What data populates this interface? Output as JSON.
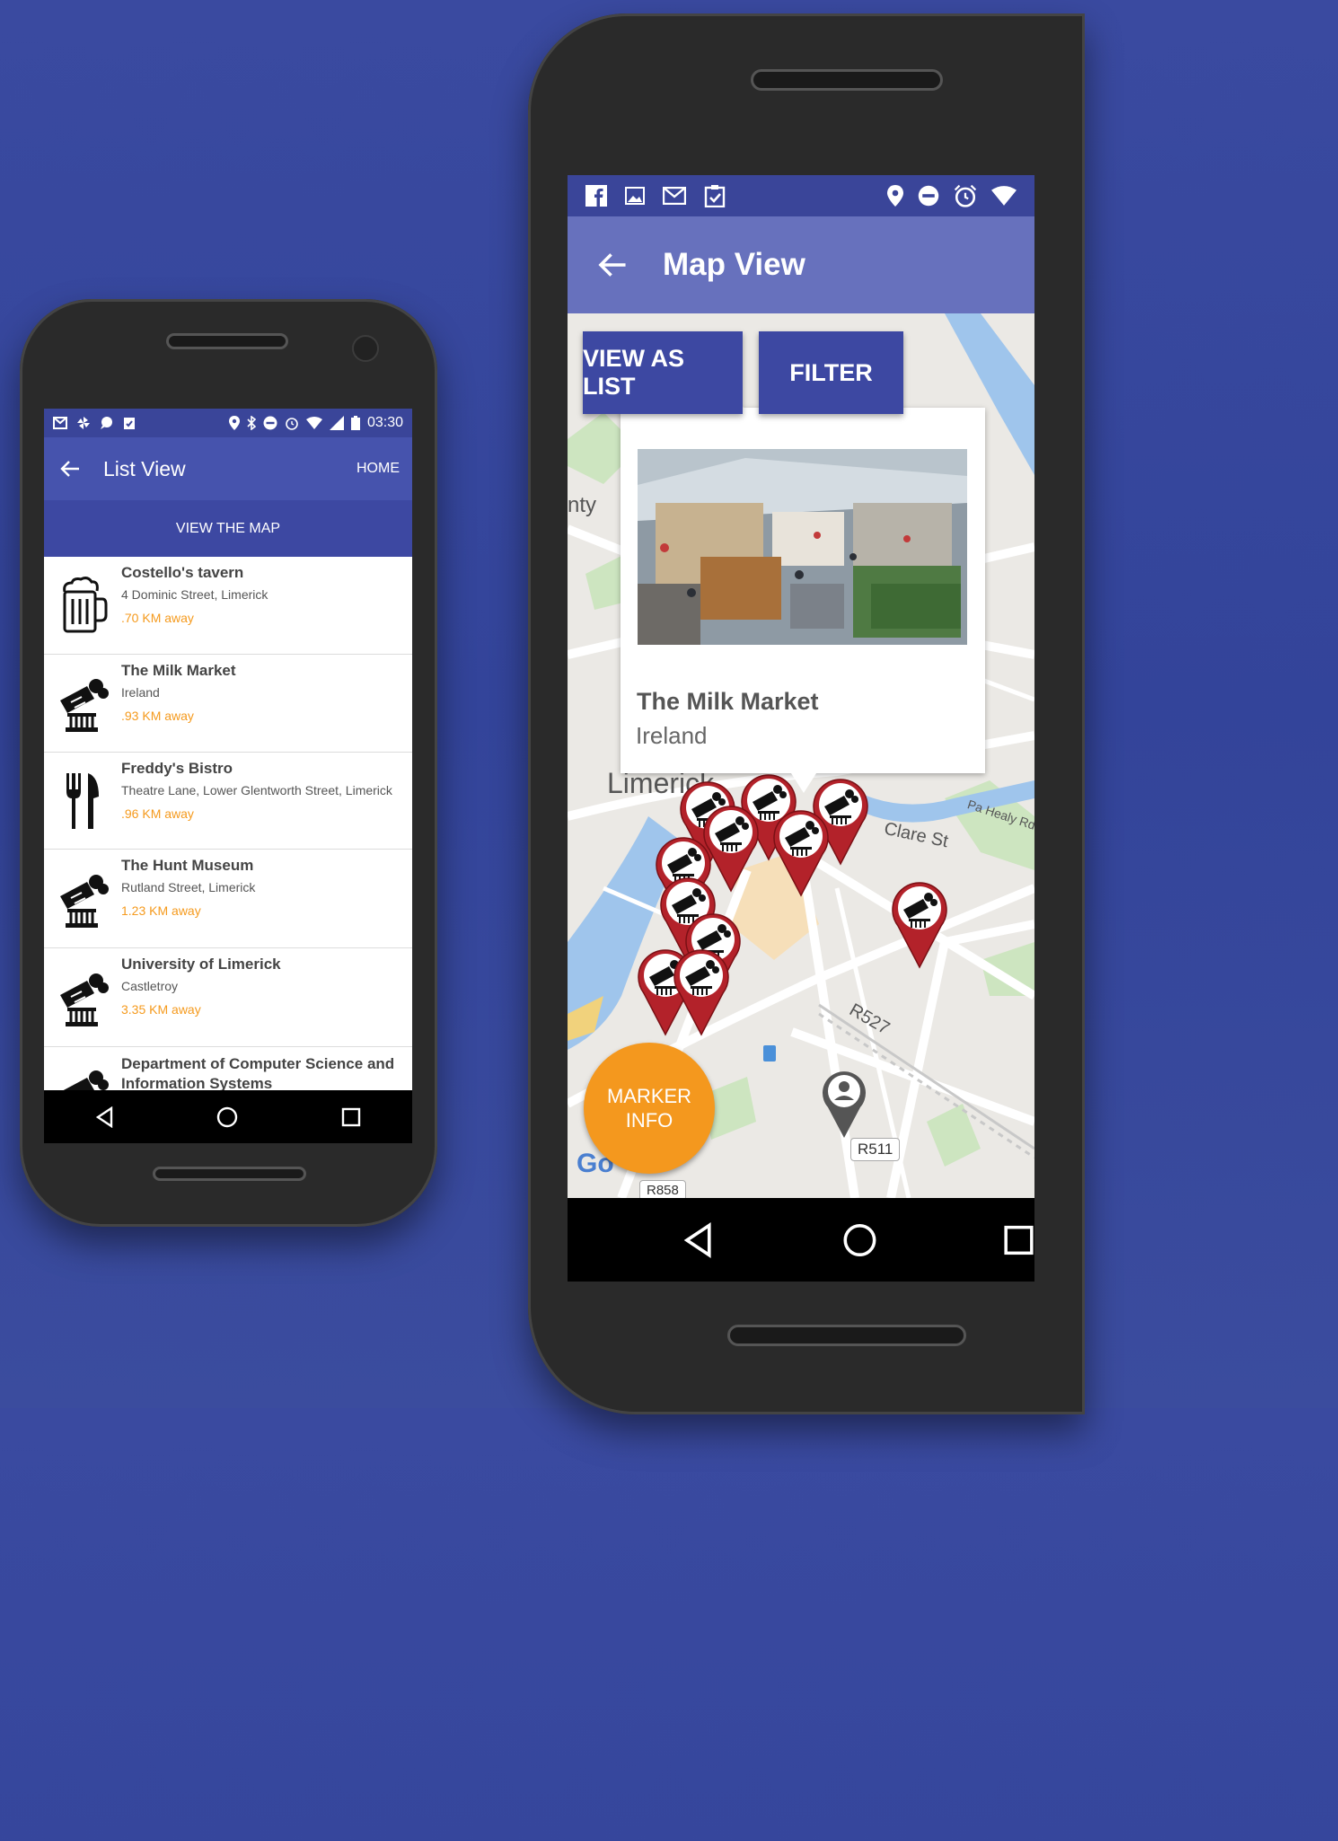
{
  "colors": {
    "background": "#34469b",
    "appbar_primary": "#4653ad",
    "appbar_map": "#6771bd",
    "statusbar": "#3a4599",
    "button": "#3d48a2",
    "distance_orange": "#f59a1d",
    "fab_orange": "#f4981e",
    "marker_red": "#b3222a"
  },
  "list_phone": {
    "statusbar": {
      "time": "03:30"
    },
    "appbar": {
      "title": "List View",
      "home_label": "HOME"
    },
    "view_map_label": "VIEW THE MAP",
    "items": [
      {
        "name": "Costello's tavern",
        "address": "4 Dominic Street, Limerick",
        "distance": ".70 KM away",
        "icon": "beer-mug-icon"
      },
      {
        "name": "The Milk Market",
        "address": "Ireland",
        "distance": ".93 KM away",
        "icon": "monument-icon"
      },
      {
        "name": "Freddy's Bistro",
        "address": "Theatre Lane, Lower Glentworth Street, Limerick",
        "distance": ".96 KM away",
        "icon": "cutlery-icon"
      },
      {
        "name": "The Hunt Museum",
        "address": "Rutland Street, Limerick",
        "distance": "1.23 KM away",
        "icon": "monument-icon"
      },
      {
        "name": "University of Limerick",
        "address": "Castletroy",
        "distance": "3.35 KM away",
        "icon": "monument-icon"
      },
      {
        "name": "Department of Computer Science and Information Systems",
        "address": "",
        "distance": "",
        "icon": "monument-icon"
      }
    ]
  },
  "map_phone": {
    "appbar": {
      "title": "Map View"
    },
    "buttons": {
      "view_as_list": "VIEW AS LIST",
      "filter": "FILTER"
    },
    "info_window": {
      "title": "The Milk Market",
      "subtitle": "Ireland"
    },
    "map_labels": {
      "limerick": "Limerick",
      "nty": "nty",
      "clare_st": "Clare St",
      "pa_healy": "Pa Healy Rd",
      "r527": "R527",
      "r511": "R511",
      "r858": "R858",
      "google": "Go"
    },
    "fab": {
      "line1": "MARKER",
      "line2": "INFO"
    }
  }
}
